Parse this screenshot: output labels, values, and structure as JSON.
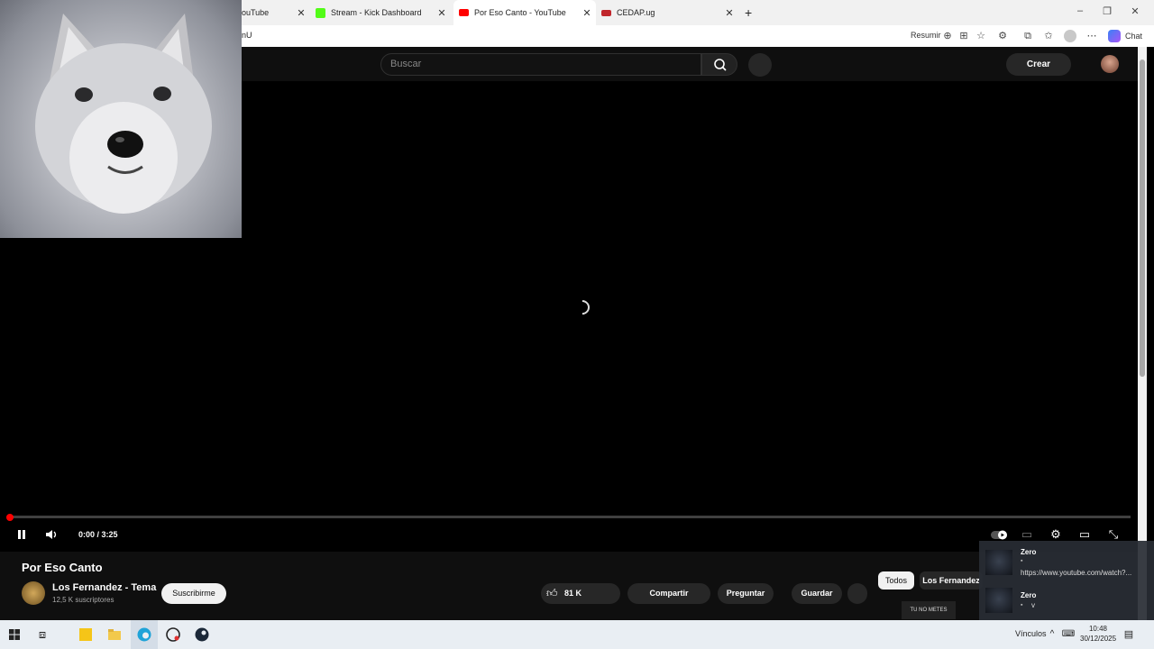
{
  "browser": {
    "tabs": [
      {
        "label": "ouTube",
        "favicon_color": "#ff0000"
      },
      {
        "label": "Stream - Kick Dashboard",
        "favicon_color": "#53fc18"
      },
      {
        "label": "Por Eso Canto - YouTube",
        "favicon_color": "#ff0000",
        "active": true
      },
      {
        "label": "CEDAP.ug",
        "favicon_color": "#c0262c"
      }
    ],
    "new_tab_glyph": "+",
    "address_fragment": "nU",
    "toolbar": {
      "summarize_label": "Resumir",
      "chat_label": "Chat"
    }
  },
  "youtube": {
    "search_placeholder": "Buscar",
    "create_label": "Crear"
  },
  "player": {
    "current_time": "0:00",
    "duration": "3:25",
    "time_display": "0:00 / 3:25",
    "progress_fraction": 0.0,
    "state": "loading"
  },
  "video": {
    "title": "Por Eso Canto",
    "channel": "Los Fernandez - Tema",
    "subscribers": "12,5 K suscriptores",
    "subscribe_label": "Suscribirme",
    "likes": "81 K",
    "share_label": "Compartir",
    "ask_label": "Preguntar",
    "save_label": "Guardar"
  },
  "chips": {
    "all": "Todos",
    "channel": "Los Fernandez"
  },
  "thumbnail_text": "TU NO METES CABRA",
  "chat": [
    {
      "user": "Zero",
      "message": "https://www.youtube.com/watch?..."
    },
    {
      "user": "Zero",
      "message": "v"
    }
  ],
  "taskbar": {
    "tray_label": "Vínculos",
    "time": "10:48",
    "date": "30/12/2025"
  },
  "colors": {
    "accent": "#ff0000",
    "kick": "#53fc18",
    "yt_bg": "#0f0f0f"
  }
}
